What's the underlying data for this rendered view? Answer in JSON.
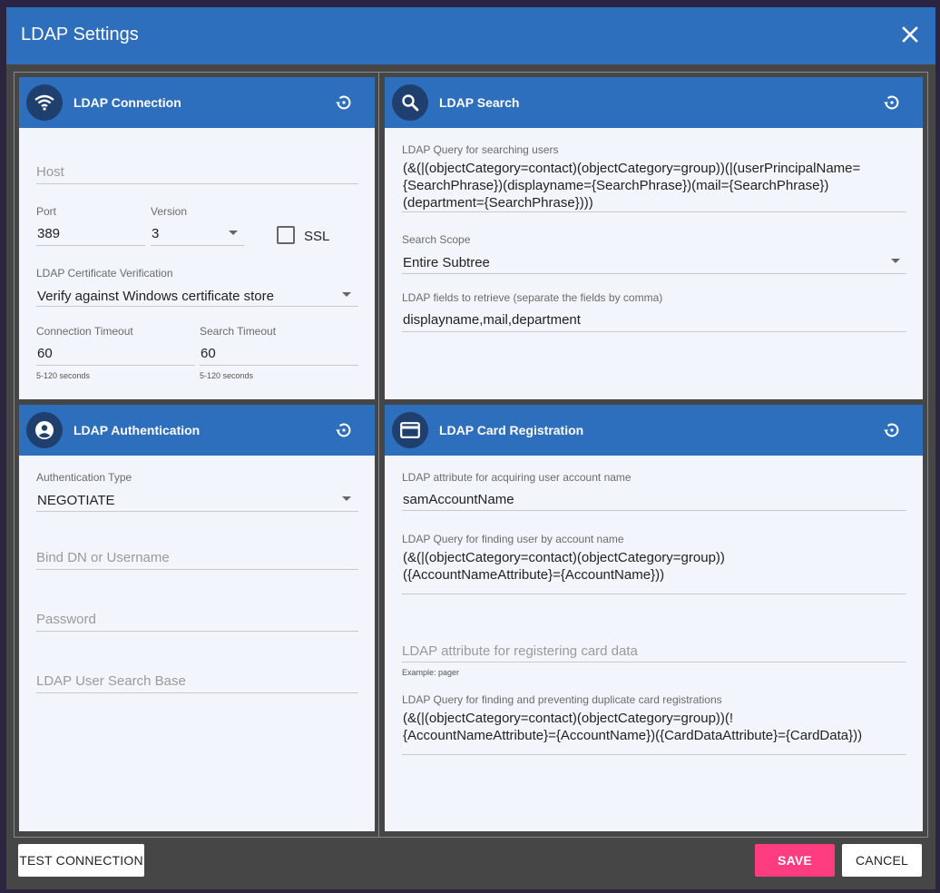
{
  "dialog": {
    "title": "LDAP Settings",
    "close_icon": "close-icon"
  },
  "connection": {
    "title": "LDAP Connection",
    "icon": "wifi-icon",
    "reset_icon": "restore-icon",
    "host_placeholder": "Host",
    "port_label": "Port",
    "port_value": "389",
    "version_label": "Version",
    "version_value": "3",
    "ssl_label": "SSL",
    "ssl_checked": false,
    "cert_label": "LDAP Certificate Verification",
    "cert_value": "Verify against Windows certificate store",
    "conn_timeout_label": "Connection Timeout",
    "conn_timeout_value": "60",
    "conn_timeout_hint": "5-120 seconds",
    "search_timeout_label": "Search Timeout",
    "search_timeout_value": "60",
    "search_timeout_hint": "5-120 seconds"
  },
  "search": {
    "title": "LDAP Search",
    "icon": "search-icon",
    "reset_icon": "restore-icon",
    "query_label": "LDAP Query for searching users",
    "query_lines": [
      "(&(|(objectCategory=contact)(objectCategory=group))(|(userPrincipalName=",
      "{SearchPhrase})(displayname={SearchPhrase})(mail={SearchPhrase})",
      "(department={SearchPhrase})))"
    ],
    "scope_label": "Search Scope",
    "scope_value": "Entire Subtree",
    "fields_label": "LDAP fields to retrieve (separate the fields by comma)",
    "fields_value": "displayname,mail,department"
  },
  "auth": {
    "title": "LDAP Authentication",
    "icon": "account-circle-icon",
    "reset_icon": "restore-icon",
    "type_label": "Authentication Type",
    "type_value": "NEGOTIATE",
    "bind_placeholder": "Bind DN or Username",
    "password_placeholder": "Password",
    "search_base_placeholder": "LDAP User Search Base"
  },
  "card": {
    "title": "LDAP Card Registration",
    "icon": "credit-card-icon",
    "reset_icon": "restore-icon",
    "account_attr_label": "LDAP attribute for acquiring user account name",
    "account_attr_value": "samAccountName",
    "find_query_label": "LDAP Query for finding user by account name",
    "find_query_lines": [
      "(&(|(objectCategory=contact)(objectCategory=group))",
      "({AccountNameAttribute}={AccountName}))"
    ],
    "card_attr_placeholder": "LDAP attribute for registering card data",
    "card_attr_hint": "Example: pager",
    "dup_query_label": "LDAP Query for finding and preventing duplicate card registrations",
    "dup_query_lines": [
      "(&(|(objectCategory=contact)(objectCategory=group))(!",
      "{AccountNameAttribute}={AccountName})({CardDataAttribute}={CardData}))"
    ]
  },
  "footer": {
    "test_label": "TEST CONNECTION",
    "save_label": "SAVE",
    "cancel_label": "CANCEL"
  },
  "colors": {
    "header": "#2e6fbd",
    "icon_circle": "#1f3f6e",
    "panel_bg": "#f2f5fb",
    "dialog_bg": "#464646",
    "save": "#ff3c80"
  }
}
